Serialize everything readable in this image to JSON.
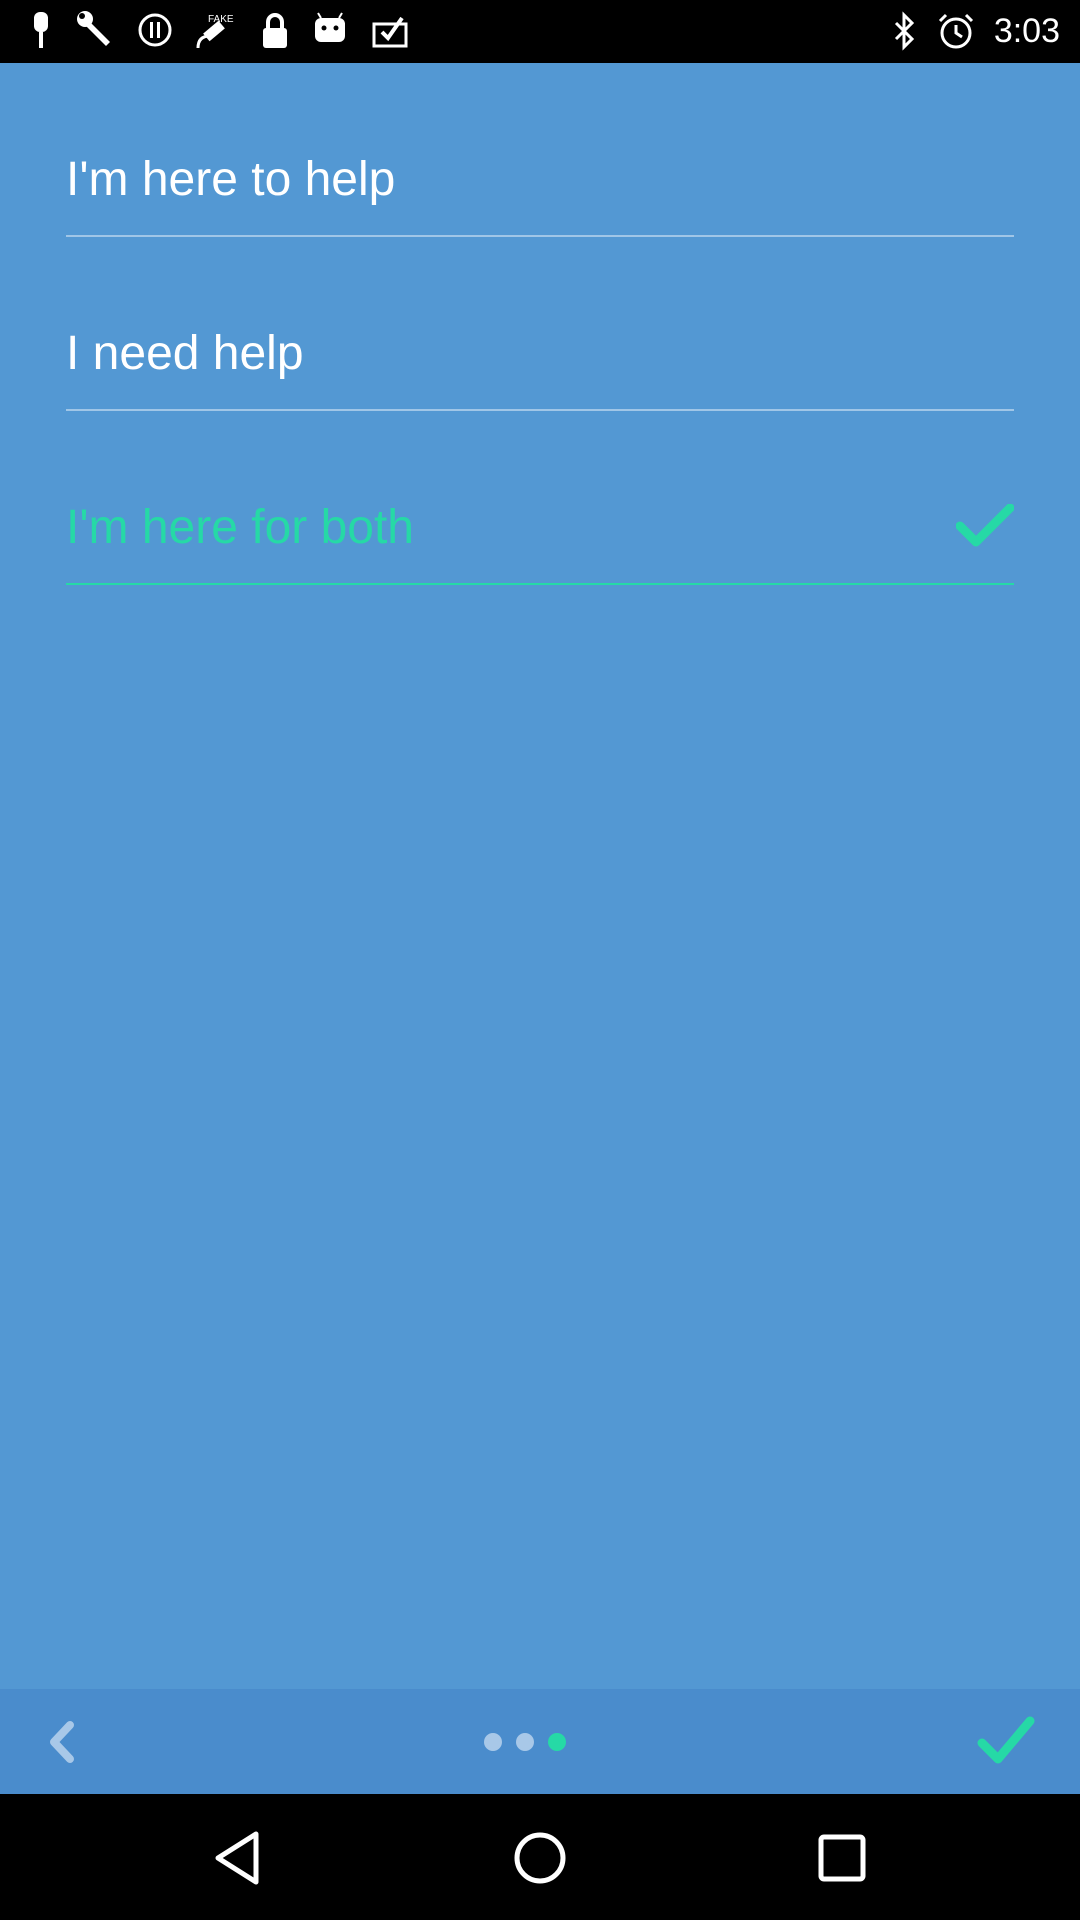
{
  "status_bar": {
    "time": "3:03",
    "left_icons": [
      "pin-icon",
      "wrench-icon",
      "info-icon",
      "fake-gps-icon",
      "lock-icon",
      "android-icon",
      "clipboard-check-icon"
    ],
    "right_icons": [
      "bluetooth-icon",
      "alarm-icon"
    ]
  },
  "options": [
    {
      "label": "I'm here to help",
      "selected": false
    },
    {
      "label": "I need help",
      "selected": false
    },
    {
      "label": "I'm here for both",
      "selected": true
    }
  ],
  "pager": {
    "current": 3,
    "total": 3
  },
  "colors": {
    "background": "#5398d3",
    "bottom_bar": "#4a8ccc",
    "accent": "#26d9a6",
    "text": "#ffffff"
  },
  "bottom_bar": {
    "back_icon": "chevron-left-icon",
    "done_icon": "check-icon"
  },
  "nav_bar": {
    "icons": [
      "back-triangle-icon",
      "home-circle-icon",
      "recents-square-icon"
    ]
  }
}
